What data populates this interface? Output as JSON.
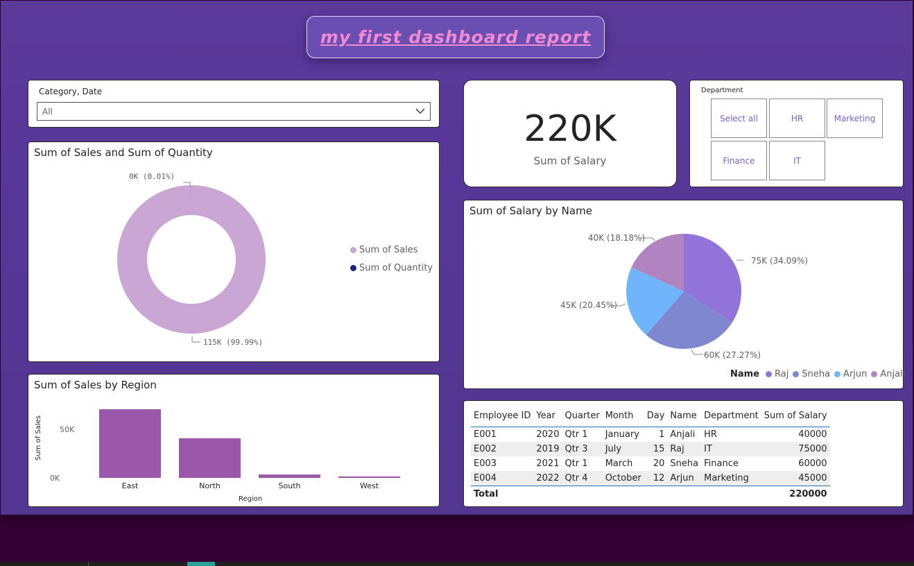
{
  "report": {
    "title": "my first dashboard report"
  },
  "slicer_category": {
    "label": "Category, Date",
    "value": "All"
  },
  "donut": {
    "title": "Sum of Sales and Sum of Quantity",
    "legend": [
      {
        "name": "Sum of Sales",
        "color": "#c9a6d4"
      },
      {
        "name": "Sum of Quantity",
        "color": "#1a237e"
      }
    ],
    "labels": {
      "small": "0K (0.01%)",
      "large": "115K (99.99%)"
    }
  },
  "kpi": {
    "value": "220K",
    "label": "Sum of Salary"
  },
  "department": {
    "label": "Department",
    "tiles": [
      "Select all",
      "HR",
      "Marketing",
      "Finance",
      "IT"
    ]
  },
  "pie": {
    "title": "Sum of Salary by Name",
    "legend_title": "Name",
    "labels": {
      "raj": "75K (34.09%)",
      "sneha": "60K (27.27%)",
      "arjun": "45K (20.45%)",
      "anjali": "40K (18.18%)"
    }
  },
  "bar": {
    "title": "Sum of Sales by Region",
    "ylabel": "Sum of Sales",
    "xlabel": "Region",
    "yticks": [
      "50K",
      "0K"
    ]
  },
  "table": {
    "headers": [
      "Employee ID",
      "Year",
      "Quarter",
      "Month",
      "Day",
      "Name",
      "Department",
      "Sum of Salary"
    ],
    "rows": [
      [
        "E001",
        "2020",
        "Qtr 1",
        "January",
        "1",
        "Anjali",
        "HR",
        "40000"
      ],
      [
        "E002",
        "2019",
        "Qtr 3",
        "July",
        "15",
        "Raj",
        "IT",
        "75000"
      ],
      [
        "E003",
        "2021",
        "Qtr 1",
        "March",
        "20",
        "Sneha",
        "Finance",
        "60000"
      ],
      [
        "E004",
        "2022",
        "Qtr 4",
        "October",
        "12",
        "Arjun",
        "Marketing",
        "45000"
      ]
    ],
    "total_label": "Total",
    "total_value": "220000"
  },
  "chart_data": [
    {
      "type": "pie",
      "title": "Sum of Sales and Sum of Quantity",
      "hole": true,
      "categories": [
        "Sum of Sales",
        "Sum of Quantity"
      ],
      "values": [
        115000,
        11.5
      ],
      "percentages": [
        99.99,
        0.01
      ],
      "colors": [
        "#c9a6d4",
        "#1a237e"
      ]
    },
    {
      "type": "pie",
      "title": "Sum of Salary by Name",
      "categories": [
        "Raj",
        "Sneha",
        "Arjun",
        "Anjali"
      ],
      "values": [
        75000,
        60000,
        45000,
        40000
      ],
      "percentages": [
        34.09,
        27.27,
        20.45,
        18.18
      ],
      "colors": [
        "#9173d9",
        "#7f87d0",
        "#6fb5fb",
        "#b283c1"
      ]
    },
    {
      "type": "bar",
      "title": "Sum of Sales by Region",
      "categories": [
        "East",
        "North",
        "South",
        "West"
      ],
      "values": [
        71000,
        41000,
        3500,
        1500
      ],
      "xlabel": "Region",
      "ylabel": "Sum of Sales",
      "ylim": [
        0,
        71000
      ],
      "yticks": [
        0,
        50000
      ],
      "color": "#9c57ab"
    }
  ]
}
